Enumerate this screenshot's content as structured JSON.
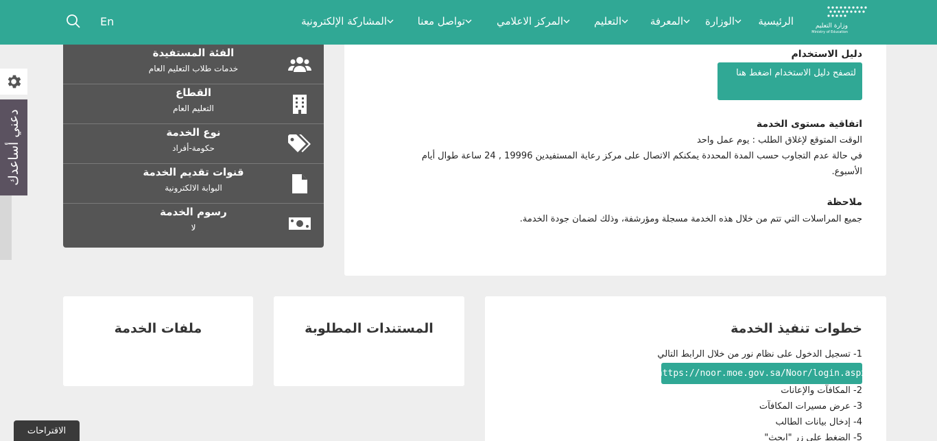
{
  "header": {
    "logo_text": "وزارة التعليم Ministry of Education",
    "nav": [
      {
        "label": "الرئيسية"
      },
      {
        "label": "الوزارة"
      },
      {
        "label": "المعرفة"
      },
      {
        "label": "التعليم"
      },
      {
        "label": "المركز الاعلامي"
      },
      {
        "label": "تواصل معنا"
      },
      {
        "label": "المشاركة الإلكترونية"
      }
    ],
    "lang": "En",
    "search_icon": "search-icon"
  },
  "helper": {
    "label": "دعني أساعدك",
    "gear_icon": "gear-icon"
  },
  "info": [
    {
      "title": "الفئة المستفيدة",
      "value": "خدمات طلاب التعليم العام",
      "icon": "users-icon"
    },
    {
      "title": "القطاع",
      "value": "التعليم العام",
      "icon": "building-icon"
    },
    {
      "title": "نوع الخدمة",
      "value": "حكومة-أفراد",
      "icon": "tags-icon"
    },
    {
      "title": "قنوات تقديم الخدمة",
      "value": "البوابة الالكترونية",
      "icon": "file-icon"
    },
    {
      "title": "رسوم الخدمة",
      "value": "لا",
      "icon": "money-icon"
    }
  ],
  "main": {
    "guide_title": "دليل الاستخدام",
    "guide_button": "لتصفح دليل الاستخدام اضغط هنا",
    "sla_title": "اتفاقية مستوى الخدمة",
    "sla_line1": "الوقت المتوقع لإغلاق الطلب : يوم عمل واحد",
    "sla_line2": "في حالة عدم التجاوب حسب المدة المحددة يمكنكم الاتصال على مركز رعاية المستفيدين 19996 , 24 ساعة طوال أيام الأسبوع.",
    "note_title": "ملاحظة",
    "note_text": "جميع المراسلات التي تتم من خلال هذه الخدمة مسجلة ومؤرشفة، وذلك لضمان جودة الخدمة."
  },
  "steps": {
    "title": "خطوات تنفيذ الخدمة",
    "step1": "1- تسجيل الدخول على نظام نور من خلال الرابط التالي",
    "link": "https://noor.moe.gov.sa/Noor/login.aspx",
    "step2": "2- المكافآت والإعانات",
    "step3": "3- عرض مسيرات المكافآت",
    "step4": "4- إدخال بيانات الطالب",
    "step5": "5- الضغط على زر \"ابحث\""
  },
  "docs_title": "المستندات المطلوبة",
  "files_title": "ملفات الخدمة",
  "suggest_label": "الاقتراحات"
}
